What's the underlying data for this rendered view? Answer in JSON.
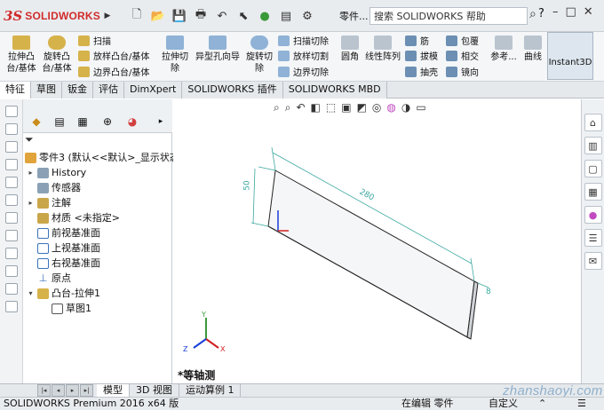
{
  "app": {
    "logo_ds": "3S",
    "logo_text": "SOLIDWORKS"
  },
  "quickbar": {
    "part_label": "零件..."
  },
  "search": {
    "placeholder": "搜索 SOLIDWORKS 帮助"
  },
  "help_label": "?",
  "window": {
    "min": "–",
    "max": "□",
    "close": "✕"
  },
  "commands": {
    "extrude_boss": "拉伸凸\n台/基体",
    "revolve_boss": "旋转凸\n台/基体",
    "sweep": "扫描",
    "loft_boss": "放样凸台/基体",
    "boundary_boss": "边界凸台/基体",
    "extrude_cut": "拉伸切\n除",
    "hole_wizard": "异型孔向导",
    "revolve_cut": "旋转切\n除",
    "swept_cut": "扫描切除",
    "lofted_cut": "放样切割",
    "boundary_cut": "边界切除",
    "fillet": "圆角",
    "linear_pattern": "线性阵列",
    "rib": "筋",
    "draft": "拔模",
    "shell": "抽壳",
    "wrap": "包覆",
    "intersect": "相交",
    "mirror": "镜向",
    "reference": "参考...",
    "curves": "曲线",
    "instant3d": "Instant3D"
  },
  "tabs": [
    "特征",
    "草图",
    "钣金",
    "评估",
    "DimXpert",
    "SOLIDWORKS 插件",
    "SOLIDWORKS MBD"
  ],
  "tree": {
    "root": "零件3 (默认<<默认>_显示状态",
    "items": [
      {
        "label": "History",
        "arrow": "▸"
      },
      {
        "label": "传感器",
        "arrow": ""
      },
      {
        "label": "注解",
        "arrow": "▸"
      },
      {
        "label": "材质 <未指定>",
        "arrow": ""
      },
      {
        "label": "前视基准面",
        "arrow": ""
      },
      {
        "label": "上视基准面",
        "arrow": ""
      },
      {
        "label": "右视基准面",
        "arrow": ""
      },
      {
        "label": "原点",
        "arrow": ""
      },
      {
        "label": "凸台-拉伸1",
        "arrow": "▾"
      },
      {
        "label": "草图1",
        "arrow": ""
      }
    ]
  },
  "viewport": {
    "view_name": "*等轴测",
    "dim_length": "280",
    "dim_height": "50",
    "dim_thickness": "8",
    "axis_y": "Y",
    "axis_x": "X",
    "axis_z": "Z"
  },
  "bottom_tabs": [
    "模型",
    "3D 视图",
    "运动算例 1"
  ],
  "status": {
    "left": "SOLIDWORKS Premium 2016 x64 版",
    "editing": "在编辑 零件",
    "custom": "自定义"
  },
  "watermark": "zhanshaoyi.com",
  "colors": {
    "accent": "#d12b2b",
    "dim": "#3aa7a0",
    "part_edge": "#222222",
    "tree_icon": "#3a73b8"
  }
}
